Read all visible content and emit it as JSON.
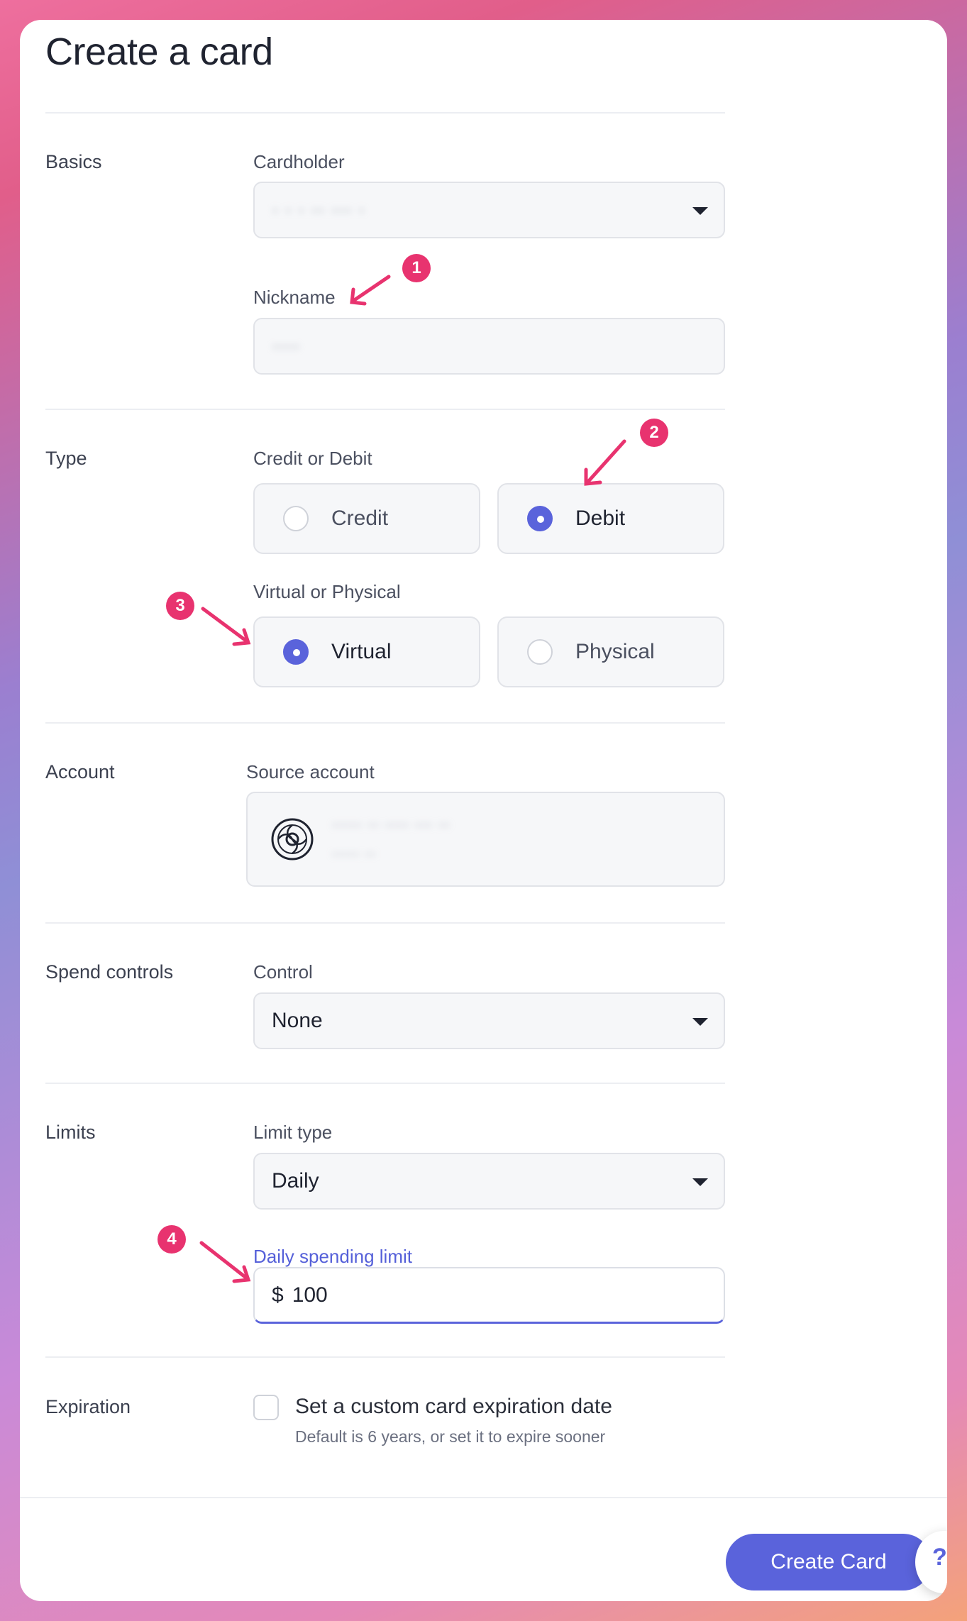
{
  "page": {
    "title": "Create a card"
  },
  "basics": {
    "section_label": "Basics",
    "cardholder_label": "Cardholder",
    "cardholder_value": "· · · ·· ··· ·",
    "nickname_label": "Nickname",
    "nickname_value": "····"
  },
  "type": {
    "section_label": "Type",
    "credit_debit_label": "Credit or Debit",
    "credit_label": "Credit",
    "debit_label": "Debit",
    "selected_credit_debit": "Debit",
    "virtual_physical_label": "Virtual or Physical",
    "virtual_label": "Virtual",
    "physical_label": "Physical",
    "selected_virtual_physical": "Virtual"
  },
  "account": {
    "section_label": "Account",
    "source_label": "Source account",
    "source_name": "····· ·· ···· ··· ··",
    "source_sub": "····· ··"
  },
  "spend_controls": {
    "section_label": "Spend controls",
    "control_label": "Control",
    "control_value": "None"
  },
  "limits": {
    "section_label": "Limits",
    "limit_type_label": "Limit type",
    "limit_type_value": "Daily",
    "spending_limit_label": "Daily spending limit",
    "currency_symbol": "$",
    "spending_limit_value": "100"
  },
  "expiration": {
    "section_label": "Expiration",
    "checkbox_label": "Set a custom card expiration date",
    "checkbox_checked": false,
    "help_text": "Default is 6 years, or set it to expire sooner"
  },
  "footer": {
    "create_button": "Create Card",
    "help_icon": "?"
  },
  "annotations": [
    {
      "number": "1"
    },
    {
      "number": "2"
    },
    {
      "number": "3"
    },
    {
      "number": "4"
    }
  ],
  "colors": {
    "accent": "#5a63db",
    "annotation": "#e8336f"
  }
}
